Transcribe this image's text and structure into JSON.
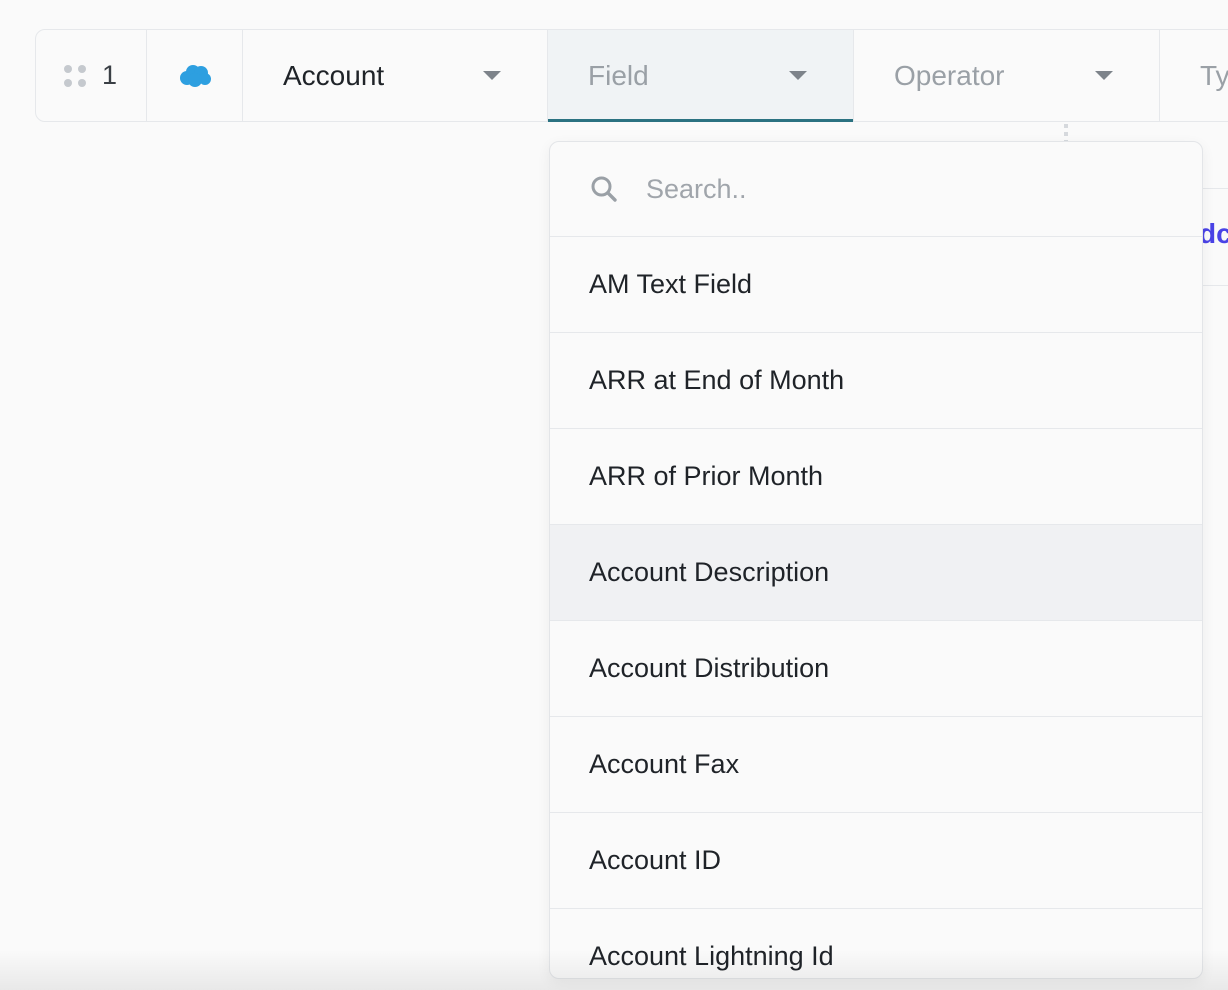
{
  "row": {
    "index": "1",
    "source_icon": "salesforce-cloud-icon",
    "object_select": {
      "value": "Account"
    },
    "field_select": {
      "placeholder": "Field"
    },
    "operator_select": {
      "placeholder": "Operator"
    },
    "type_select": {
      "placeholder": "Ty"
    }
  },
  "background_link": {
    "label": "dc"
  },
  "dropdown": {
    "search_placeholder": "Search..",
    "options": [
      "AM Text Field",
      "ARR at End of Month",
      "ARR of Prior Month",
      "Account Description",
      "Account Distribution",
      "Account Fax",
      "Account ID",
      "Account Lightning Id"
    ],
    "hovered_option": "Account Description"
  },
  "colors": {
    "accent_underline": "#2b7281",
    "salesforce_blue": "#2d9fe0",
    "link": "#4a43e6"
  }
}
